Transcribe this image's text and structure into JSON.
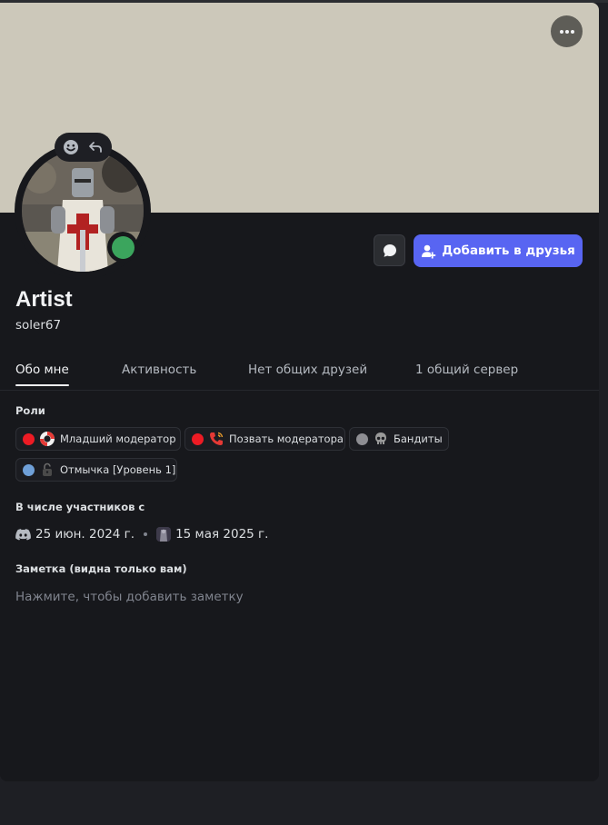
{
  "profile": {
    "display_name": "Artist",
    "username": "soler67",
    "status": "online",
    "banner_color": "#ccc8ba"
  },
  "actions": {
    "more_icon": "ellipsis-icon",
    "message_icon": "message-icon",
    "add_friend_label": "Добавить в друзья",
    "add_friend_color": "#5865f2",
    "avatar_emoji_icon": "emoji-icon",
    "avatar_reply_icon": "reply-icon"
  },
  "tabs": [
    {
      "label": "Обо мне",
      "active": true
    },
    {
      "label": "Активность",
      "active": false
    },
    {
      "label": "Нет общих друзей",
      "active": false
    },
    {
      "label": "1 общий сервер",
      "active": false
    }
  ],
  "roles": {
    "title": "Роли",
    "items": [
      {
        "label": "Младший модератор",
        "color": "#ed1b24",
        "icon": "lifebuoy-icon"
      },
      {
        "label": "Позвать модератора",
        "color": "#ed1b24",
        "icon": "phone-icon"
      },
      {
        "label": "Бандиты",
        "color": "#8e8e93",
        "icon": "skull-icon"
      },
      {
        "label": "Отмычка [Уровень 1]",
        "color": "#6fa0d8",
        "icon": "lock-icon"
      }
    ]
  },
  "member_since": {
    "title": "В числе участников с",
    "discord_date": "25 июн. 2024 г.",
    "server_date": "15 мая 2025 г."
  },
  "note": {
    "title": "Заметка (видна только вам)",
    "placeholder": "Нажмите, чтобы добавить заметку"
  }
}
